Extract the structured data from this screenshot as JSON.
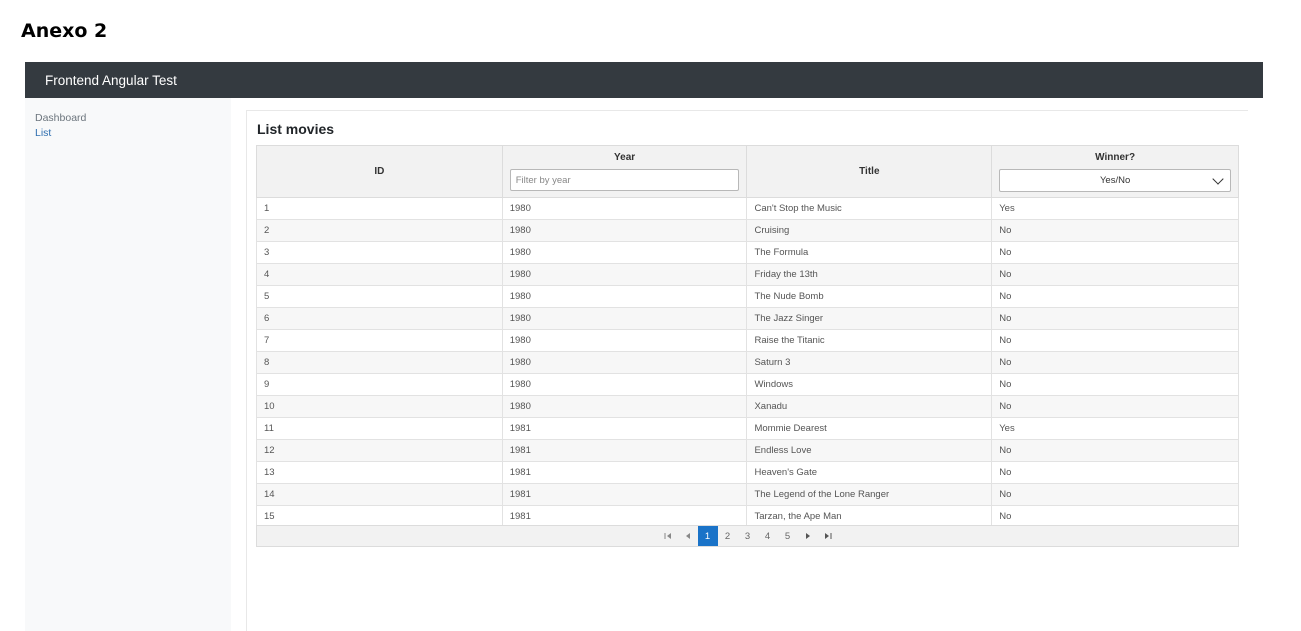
{
  "document": {
    "heading": "Anexo 2"
  },
  "navbar": {
    "brand": "Frontend Angular Test"
  },
  "sidebar": {
    "items": [
      {
        "label": "Dashboard"
      },
      {
        "label": "List"
      }
    ]
  },
  "main": {
    "title": "List movies",
    "columns": {
      "id": "ID",
      "year": "Year",
      "title": "Title",
      "winner": "Winner?"
    },
    "year_filter": {
      "placeholder": "Filter by year",
      "value": ""
    },
    "winner_filter": {
      "selected": "Yes/No"
    },
    "rows": [
      {
        "id": "1",
        "year": "1980",
        "title": "Can't Stop the Music",
        "winner": "Yes"
      },
      {
        "id": "2",
        "year": "1980",
        "title": "Cruising",
        "winner": "No"
      },
      {
        "id": "3",
        "year": "1980",
        "title": "The Formula",
        "winner": "No"
      },
      {
        "id": "4",
        "year": "1980",
        "title": "Friday the 13th",
        "winner": "No"
      },
      {
        "id": "5",
        "year": "1980",
        "title": "The Nude Bomb",
        "winner": "No"
      },
      {
        "id": "6",
        "year": "1980",
        "title": "The Jazz Singer",
        "winner": "No"
      },
      {
        "id": "7",
        "year": "1980",
        "title": "Raise the Titanic",
        "winner": "No"
      },
      {
        "id": "8",
        "year": "1980",
        "title": "Saturn 3",
        "winner": "No"
      },
      {
        "id": "9",
        "year": "1980",
        "title": "Windows",
        "winner": "No"
      },
      {
        "id": "10",
        "year": "1980",
        "title": "Xanadu",
        "winner": "No"
      },
      {
        "id": "11",
        "year": "1981",
        "title": "Mommie Dearest",
        "winner": "Yes"
      },
      {
        "id": "12",
        "year": "1981",
        "title": "Endless Love",
        "winner": "No"
      },
      {
        "id": "13",
        "year": "1981",
        "title": "Heaven's Gate",
        "winner": "No"
      },
      {
        "id": "14",
        "year": "1981",
        "title": "The Legend of the Lone Ranger",
        "winner": "No"
      },
      {
        "id": "15",
        "year": "1981",
        "title": "Tarzan, the Ape Man",
        "winner": "No"
      }
    ],
    "pagination": {
      "pages": [
        "1",
        "2",
        "3",
        "4",
        "5"
      ],
      "current": "1",
      "controls": [
        "first-page-icon",
        "prev-page-icon",
        "next-page-icon",
        "last-page-icon"
      ]
    }
  },
  "colors": {
    "navbar_bg": "#343a40",
    "sidebar_bg": "#f8f9fa",
    "link": "#2f6fb0",
    "active_page": "#1a73c8"
  }
}
